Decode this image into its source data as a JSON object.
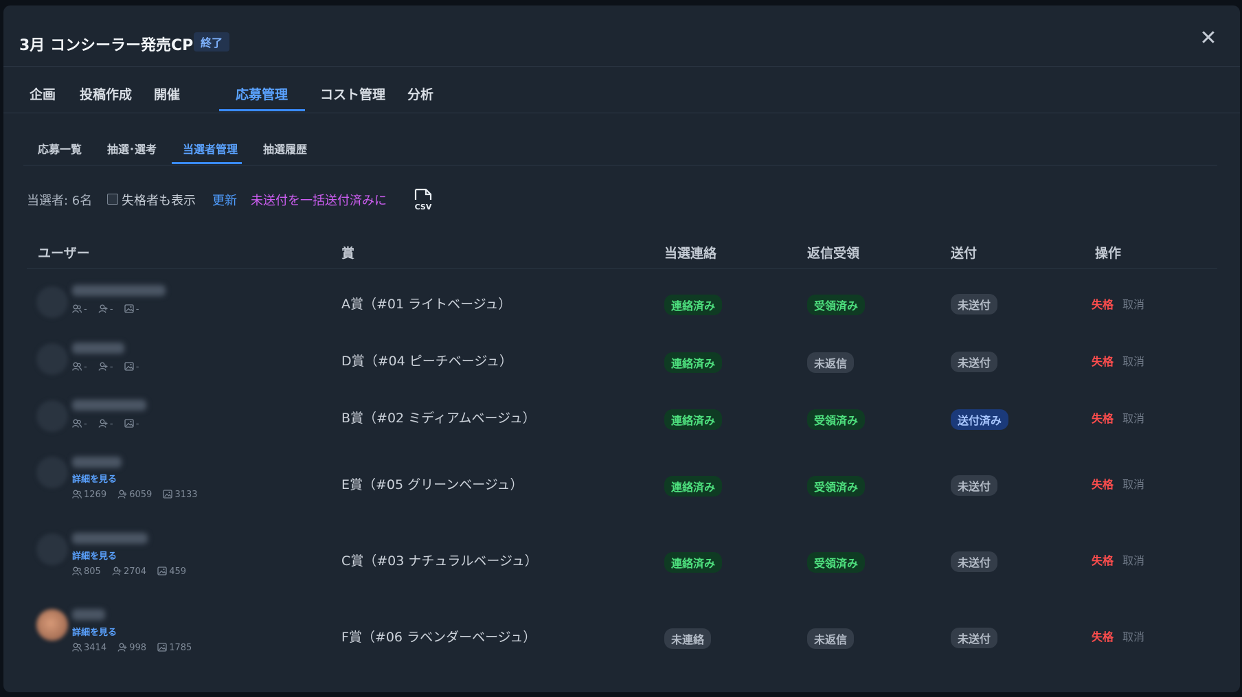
{
  "header": {
    "title": "3月 コンシーラー発売CP",
    "status": "終了",
    "close_icon": "close-icon"
  },
  "tabs": [
    {
      "label": "企画"
    },
    {
      "label": "投稿作成"
    },
    {
      "label": "開催"
    },
    {
      "label": "応募管理",
      "active": true
    },
    {
      "label": "コスト管理"
    },
    {
      "label": "分析"
    }
  ],
  "subtabs": [
    {
      "label": "応募一覧"
    },
    {
      "label": "抽選･選考"
    },
    {
      "label": "当選者管理",
      "active": true
    },
    {
      "label": "抽選履歴"
    }
  ],
  "toolbar": {
    "winner_count": "当選者: 6名",
    "show_disqualified_label": "失格者も表示",
    "show_disqualified_checked": false,
    "refresh_label": "更新",
    "bulk_sent_label": "未送付を一括送付済みに",
    "csv_icon": "csv-file-icon"
  },
  "table": {
    "headers": {
      "user": "ユーザー",
      "prize": "賞",
      "contact": "当選連絡",
      "reply": "返信受領",
      "shipping": "送付",
      "actions": "操作"
    },
    "rows": [
      {
        "prize": "A賞（#01 ライトベージュ）",
        "followers": "-",
        "following": "-",
        "posts": "-",
        "contact": "連絡済み",
        "reply": "受領済み",
        "shipping": "未送付",
        "disqualify": "失格",
        "cancel": "取消"
      },
      {
        "prize": "D賞（#04 ピーチベージュ）",
        "followers": "-",
        "following": "-",
        "posts": "-",
        "contact": "連絡済み",
        "reply": "未返信",
        "shipping": "未送付",
        "disqualify": "失格",
        "cancel": "取消"
      },
      {
        "prize": "B賞（#02 ミディアムベージュ）",
        "followers": "-",
        "following": "-",
        "posts": "-",
        "contact": "連絡済み",
        "reply": "受領済み",
        "shipping": "送付済み",
        "disqualify": "失格",
        "cancel": "取消"
      },
      {
        "prize": "E賞（#05 グリーンベージュ）",
        "detail": "詳細を見る",
        "followers": "1269",
        "following": "6059",
        "posts": "3133",
        "contact": "連絡済み",
        "reply": "受領済み",
        "shipping": "未送付",
        "disqualify": "失格",
        "cancel": "取消"
      },
      {
        "prize": "C賞（#03 ナチュラルベージュ）",
        "detail": "詳細を見る",
        "followers": "805",
        "following": "2704",
        "posts": "459",
        "contact": "連絡済み",
        "reply": "受領済み",
        "shipping": "未送付",
        "disqualify": "失格",
        "cancel": "取消"
      },
      {
        "prize": "F賞（#06 ラベンダーベージュ）",
        "detail": "詳細を見る",
        "followers": "3414",
        "following": "998",
        "posts": "1785",
        "contact": "未連絡",
        "reply": "未返信",
        "shipping": "未送付",
        "disqualify": "失格",
        "cancel": "取消"
      }
    ]
  }
}
